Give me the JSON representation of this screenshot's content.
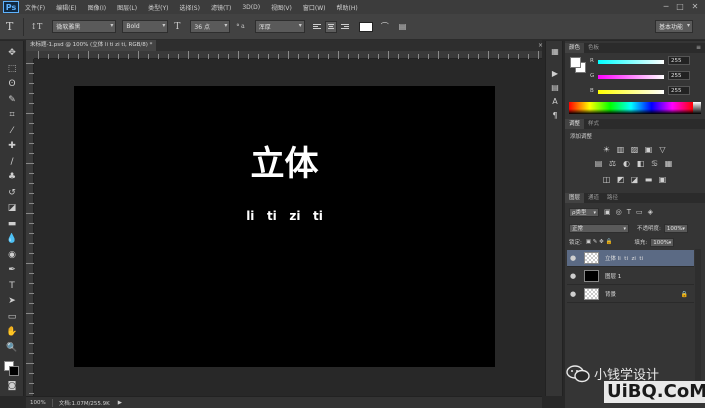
{
  "app": {
    "logo": "Ps"
  },
  "menu": [
    "文件(F)",
    "编辑(E)",
    "图像(I)",
    "图层(L)",
    "类型(Y)",
    "选择(S)",
    "滤镜(T)",
    "3D(D)",
    "视图(V)",
    "窗口(W)",
    "帮助(H)"
  ],
  "window_controls": {
    "minimize": "─",
    "maximize": "□",
    "close": "✕"
  },
  "options": {
    "tool_glyph": "T",
    "orient_glyph": "↕T",
    "font_family": "微软雅黑",
    "font_style": "Bold",
    "size_glyph": "T",
    "font_size": "36 点",
    "aa_label": "ª a",
    "aa_mode": "浑厚",
    "workspace": "基本功能"
  },
  "document": {
    "tab_title": "未标题-1.psd @ 100% (立体 li   ti   zi   ti, RGB/8) *",
    "close": "×",
    "title_text": "立体",
    "sub_text": "li   ti   zi   ti"
  },
  "status": {
    "zoom": "100%",
    "doc_info": "文档:1.07M/255.9K",
    "arrow": "▶"
  },
  "tools_icons": [
    "move-icon",
    "marquee-icon",
    "lasso-icon",
    "quick-select-icon",
    "crop-icon",
    "eyedropper-icon",
    "healing-icon",
    "brush-icon",
    "stamp-icon",
    "history-brush-icon",
    "eraser-icon",
    "gradient-icon",
    "blur-icon",
    "dodge-icon",
    "pen-icon",
    "type-icon",
    "path-select-icon",
    "shape-icon",
    "hand-icon",
    "zoom-icon"
  ],
  "tool_glyphs": [
    "✥",
    "⬚",
    "ʘ",
    "✎",
    "⌗",
    "⁄",
    "✚",
    "/",
    "♣",
    "↺",
    "◪",
    "▬",
    "💧",
    "◉",
    "✒",
    "T",
    "➤",
    "▭",
    "✋",
    "🔍"
  ],
  "strip_glyphs": [
    "▦",
    "▶",
    "▤",
    "A",
    "¶"
  ],
  "color_panel": {
    "tabs": [
      "颜色",
      "色板"
    ],
    "menu": "≡",
    "channels": [
      {
        "label": "R",
        "value": "255"
      },
      {
        "label": "G",
        "value": "255"
      },
      {
        "label": "B",
        "value": "255"
      }
    ]
  },
  "adjust_panel": {
    "tabs": [
      "调整",
      "样式"
    ],
    "title": "添加调整",
    "icons_row1": [
      "☀",
      "▥",
      "▨",
      "▣",
      "▽"
    ],
    "icons_row2": [
      "▤",
      "⚖",
      "◐",
      "◧",
      "♋",
      "▦"
    ],
    "icons_row3": [
      "◫",
      "◩",
      "◪",
      "▬",
      "▣"
    ]
  },
  "layers_panel": {
    "tabs": [
      "图层",
      "通道",
      "路径"
    ],
    "kind_label": "ρ类型",
    "filter_glyphs": [
      "▣",
      "◎",
      "T",
      "▭",
      "◈"
    ],
    "blend_mode": "正常",
    "opacity_label": "不透明度:",
    "opacity_value": "100%",
    "lock_label": "锁定:",
    "lock_glyphs": "▣ ✎ ✥ 🔒",
    "fill_label": "填充:",
    "fill_value": "100%",
    "eye": "●",
    "lock": "🔒",
    "layers": [
      {
        "name": "立体 li  ti  zi  ti",
        "selected": true,
        "thumb": "checker"
      },
      {
        "name": "图层 1",
        "selected": false,
        "thumb": "black"
      },
      {
        "name": "背景",
        "selected": false,
        "thumb": "checker",
        "locked": true
      }
    ]
  },
  "watermark": {
    "line1": "小钱学设计",
    "line2": "UiBQ.CoM"
  }
}
